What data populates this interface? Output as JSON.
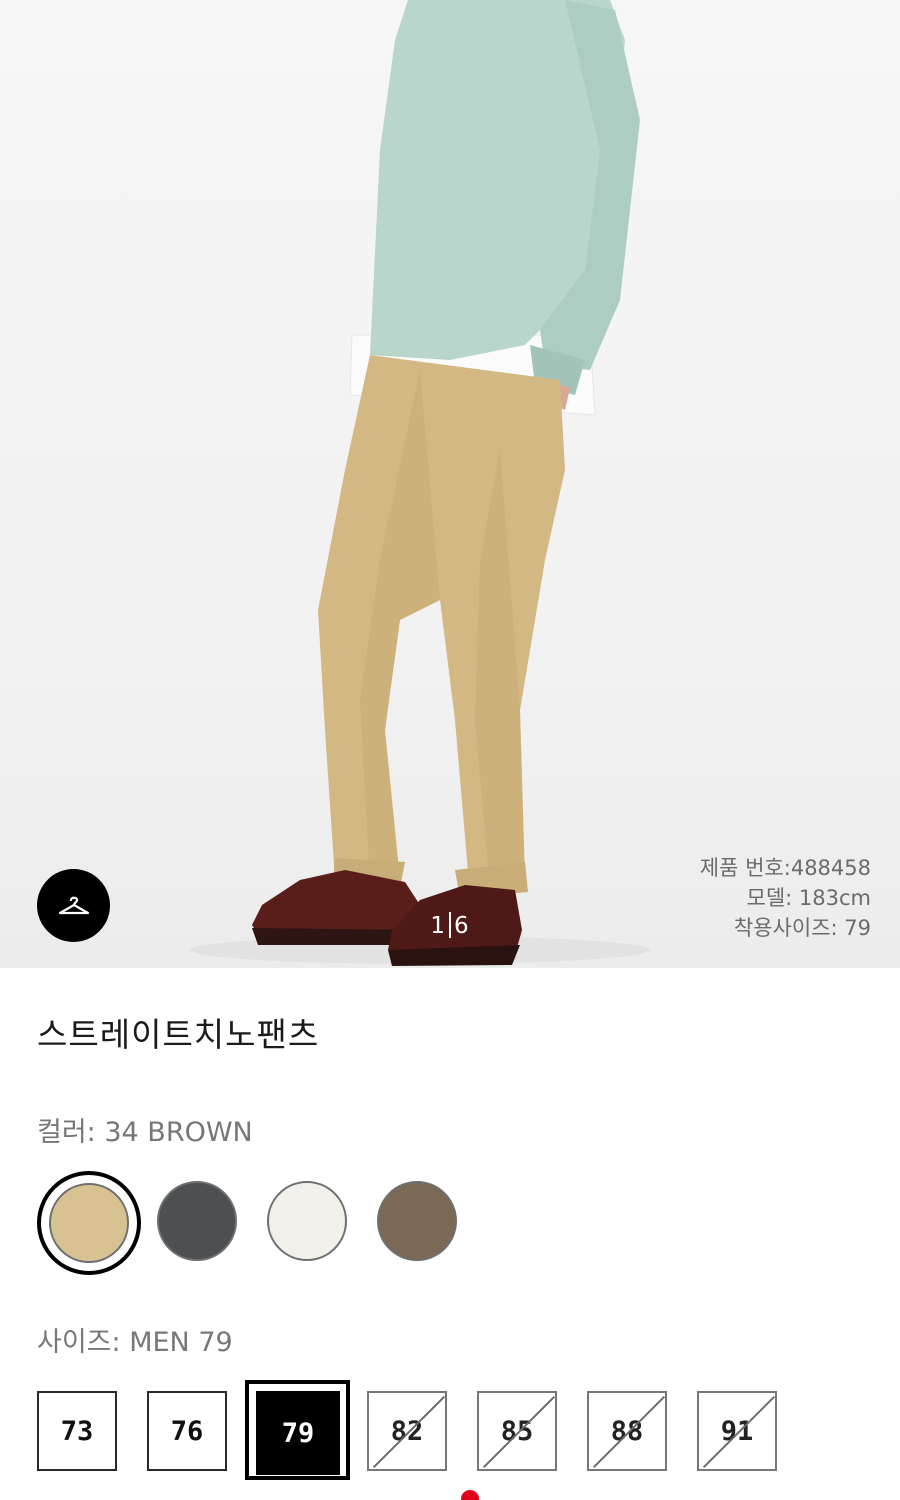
{
  "hero": {
    "counter_current": "1",
    "counter_total": "6",
    "meta_product_no": "제품 번호:488458",
    "meta_model": "모델: 183cm",
    "meta_wear_size": "착용사이즈: 79"
  },
  "product": {
    "title": "스트레이트치노팬츠"
  },
  "color": {
    "label": "컬러: 34 BROWN",
    "swatches": [
      {
        "name": "beige",
        "hex": "#d9c291",
        "selected": true
      },
      {
        "name": "gray",
        "hex": "#4d5052",
        "selected": false
      },
      {
        "name": "off-white",
        "hex": "#f1f0ea",
        "selected": false
      },
      {
        "name": "brown",
        "hex": "#7a6a55",
        "selected": false
      }
    ]
  },
  "size": {
    "label": "사이즈: MEN 79",
    "options": [
      {
        "label": "73",
        "state": "available"
      },
      {
        "label": "76",
        "state": "available"
      },
      {
        "label": "79",
        "state": "selected"
      },
      {
        "label": "82",
        "state": "unavailable"
      },
      {
        "label": "85",
        "state": "unavailable"
      },
      {
        "label": "88",
        "state": "unavailable"
      },
      {
        "label": "91",
        "state": "unavailable"
      }
    ]
  },
  "colors": {
    "sweater": "#b9d6cc",
    "pants": "#d3b883",
    "shoes": "#5a1e1a",
    "accent_dot": "#e4001c"
  }
}
